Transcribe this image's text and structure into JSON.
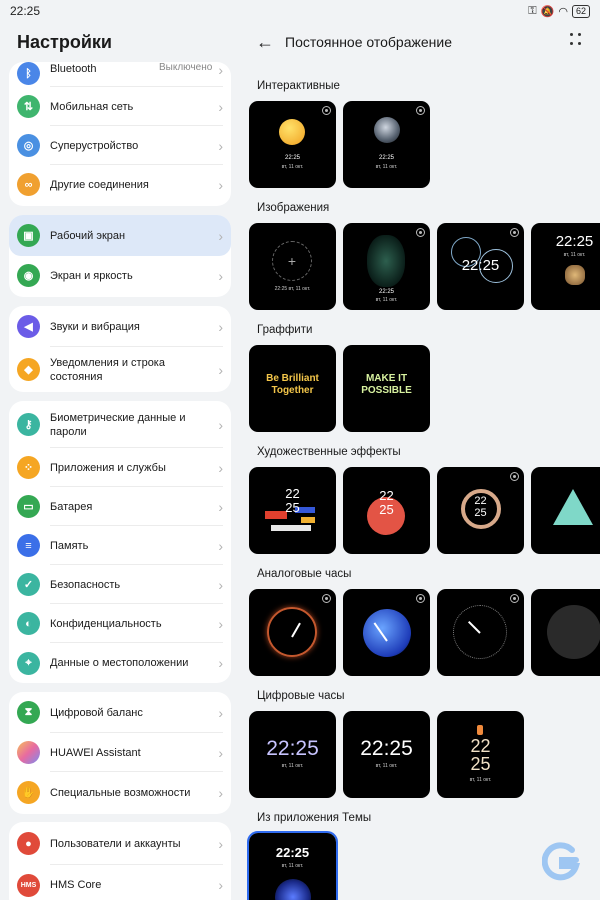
{
  "status": {
    "time": "22:25",
    "battery": "62"
  },
  "settings": {
    "title": "Настройки",
    "items": [
      {
        "label": "Bluetooth",
        "value": "Выключено",
        "icon": "bluetooth-icon",
        "color": "#4a86e8"
      },
      {
        "label": "Мобильная сеть",
        "icon": "mobile-network-icon",
        "color": "#3fb56e"
      },
      {
        "label": "Суперустройство",
        "icon": "super-device-icon",
        "color": "#4a90e2"
      },
      {
        "label": "Другие соединения",
        "icon": "link-icon",
        "color": "#f0a030"
      },
      {
        "label": "Рабочий экран",
        "icon": "home-screen-icon",
        "color": "#34a853"
      },
      {
        "label": "Экран и яркость",
        "icon": "display-icon",
        "color": "#34a853"
      },
      {
        "label": "Звуки и вибрация",
        "icon": "sound-icon",
        "color": "#6b5ce7"
      },
      {
        "label": "Уведомления и строка состояния",
        "icon": "bell-icon",
        "color": "#f5a623"
      },
      {
        "label": "Биометрические данные и пароли",
        "icon": "key-icon",
        "color": "#3bb5a0"
      },
      {
        "label": "Приложения и службы",
        "icon": "apps-icon",
        "color": "#f5a623"
      },
      {
        "label": "Батарея",
        "icon": "battery-icon",
        "color": "#34a853"
      },
      {
        "label": "Память",
        "icon": "storage-icon",
        "color": "#3b6fe8"
      },
      {
        "label": "Безопасность",
        "icon": "shield-icon",
        "color": "#3bb5a0"
      },
      {
        "label": "Конфиденциальность",
        "icon": "privacy-icon",
        "color": "#3bb5a0"
      },
      {
        "label": "Данные о местоположении",
        "icon": "location-icon",
        "color": "#3bb5a0"
      },
      {
        "label": "Цифровой баланс",
        "icon": "hourglass-icon",
        "color": "#34a853"
      },
      {
        "label": "HUAWEI Assistant",
        "icon": "assistant-icon",
        "color": "#e86aa0"
      },
      {
        "label": "Специальные возможности",
        "icon": "accessibility-icon",
        "color": "#f5a623"
      },
      {
        "label": "Пользователи и аккаунты",
        "icon": "user-icon",
        "color": "#e04a3a"
      },
      {
        "label": "HMS Core",
        "icon": "hms-icon",
        "color": "#e04a3a",
        "icon_text": "HMS"
      }
    ]
  },
  "detail": {
    "title": "Постоянное отображение",
    "sections": [
      {
        "title": "Интерактивные"
      },
      {
        "title": "Изображения"
      },
      {
        "title": "Граффити",
        "texts": [
          "Be Brilliant Together",
          "MAKE IT POSSIBLE"
        ]
      },
      {
        "title": "Художественные эффекты"
      },
      {
        "title": "Аналоговые часы"
      },
      {
        "title": "Цифровые часы"
      },
      {
        "title": "Из приложения Темы"
      }
    ],
    "clock_time": "22:25",
    "clock_hour": "22",
    "clock_minute": "25",
    "clock_date": "вт, 11 окт.",
    "clock_date_long": "22:25 вт, 11 окт."
  }
}
